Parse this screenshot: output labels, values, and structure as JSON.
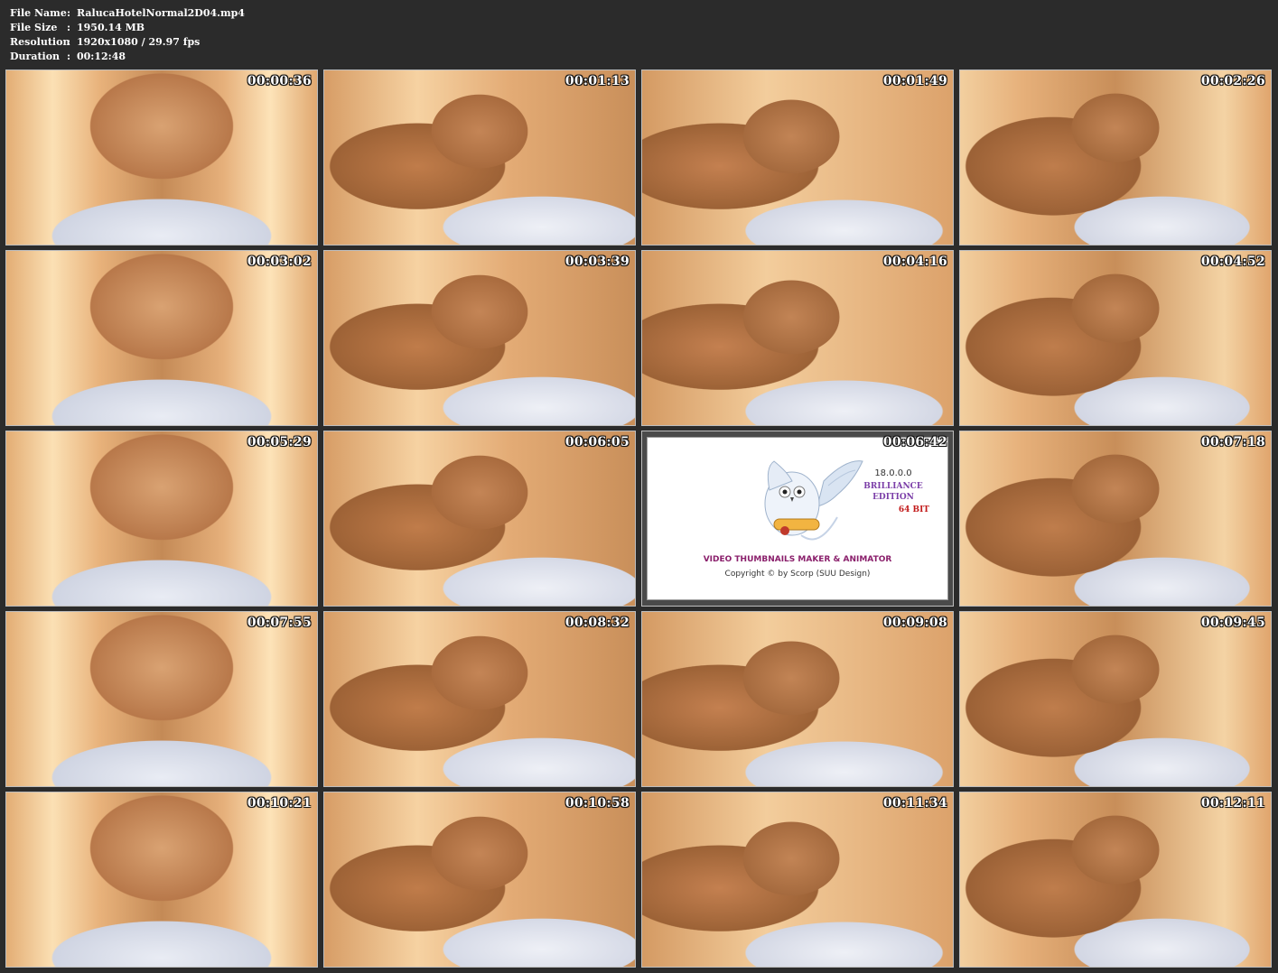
{
  "info": {
    "rows": [
      {
        "key": "File Name",
        "sep": ":",
        "value": "RalucaHotelNormal2D04.mp4"
      },
      {
        "key": "File Size",
        "sep": ":",
        "value": "1950.14 MB"
      },
      {
        "key": "Resolution",
        "sep": ":",
        "value": "1920x1080 / 29.97 fps"
      },
      {
        "key": "Duration",
        "sep": ":",
        "value": "00:12:48"
      }
    ]
  },
  "thumbnails": [
    {
      "timestamp": "00:00:36",
      "kind": "video-frame"
    },
    {
      "timestamp": "00:01:13",
      "kind": "video-frame"
    },
    {
      "timestamp": "00:01:49",
      "kind": "video-frame"
    },
    {
      "timestamp": "00:02:26",
      "kind": "video-frame"
    },
    {
      "timestamp": "00:03:02",
      "kind": "video-frame"
    },
    {
      "timestamp": "00:03:39",
      "kind": "video-frame"
    },
    {
      "timestamp": "00:04:16",
      "kind": "video-frame"
    },
    {
      "timestamp": "00:04:52",
      "kind": "video-frame"
    },
    {
      "timestamp": "00:05:29",
      "kind": "video-frame"
    },
    {
      "timestamp": "00:06:05",
      "kind": "video-frame"
    },
    {
      "timestamp": "00:06:42",
      "kind": "brand-frame"
    },
    {
      "timestamp": "00:07:18",
      "kind": "video-frame"
    },
    {
      "timestamp": "00:07:55",
      "kind": "video-frame"
    },
    {
      "timestamp": "00:08:32",
      "kind": "video-frame"
    },
    {
      "timestamp": "00:09:08",
      "kind": "video-frame"
    },
    {
      "timestamp": "00:09:45",
      "kind": "video-frame"
    },
    {
      "timestamp": "00:10:21",
      "kind": "video-frame"
    },
    {
      "timestamp": "00:10:58",
      "kind": "video-frame"
    },
    {
      "timestamp": "00:11:34",
      "kind": "video-frame"
    },
    {
      "timestamp": "00:12:11",
      "kind": "video-frame"
    }
  ],
  "brand": {
    "version": "18.0.0.0",
    "edition": "BRILLIANCE EDITION",
    "bits": "64 BIT",
    "title": "VIDEO THUMBNAILS MAKER & ANIMATOR",
    "copyright": "Copyright © by Scorp (SUU Design)",
    "logo_icon": "owl-with-scroll-icon"
  },
  "colors": {
    "background": "#2b2b2b",
    "frame_warm": "#c9935f",
    "brand_title": "#8a1f6b",
    "brand_edition": "#7b3ea8",
    "brand_bits": "#c21b1b"
  }
}
